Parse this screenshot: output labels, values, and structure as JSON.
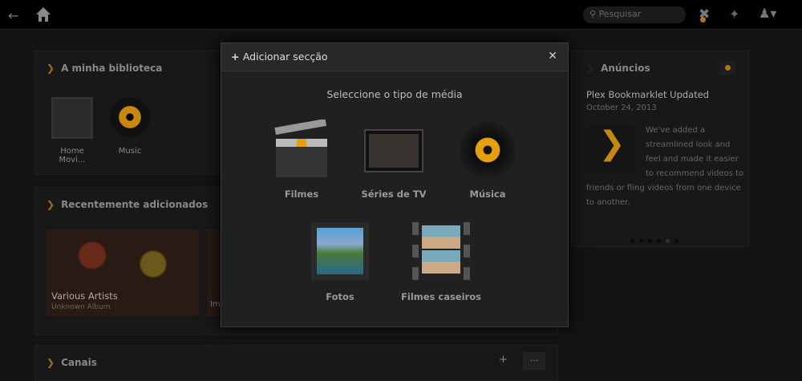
{
  "topbar": {
    "search_placeholder": "Pesquisar"
  },
  "library": {
    "title": "A minha biblioteca",
    "items": [
      {
        "label": "Home Movi..."
      },
      {
        "label": "Music"
      }
    ]
  },
  "recent": {
    "title": "Recentemente adicionados",
    "items": [
      {
        "title": "Various Artists",
        "subtitle": "Unknown Album"
      },
      {
        "title": "Im"
      }
    ]
  },
  "channels": {
    "title": "Canais",
    "add": "+",
    "more": "···"
  },
  "announcements": {
    "title": "Anúncios",
    "post_title": "Plex Bookmarklet Updated",
    "post_date": "October 24, 2013",
    "post_body": "We've added a streamlined look and feel and made it easier to recommend videos to friends or fling videos from one device to another.",
    "pages": 6,
    "active_page": 5
  },
  "modal": {
    "title": "Adicionar secção",
    "subtitle": "Seleccione o tipo de média",
    "types": [
      {
        "label": "Filmes"
      },
      {
        "label": "Séries de TV"
      },
      {
        "label": "Música"
      },
      {
        "label": "Fotos"
      },
      {
        "label": "Filmes caseiros"
      }
    ]
  },
  "colors": {
    "accent": "#e5a00d"
  }
}
